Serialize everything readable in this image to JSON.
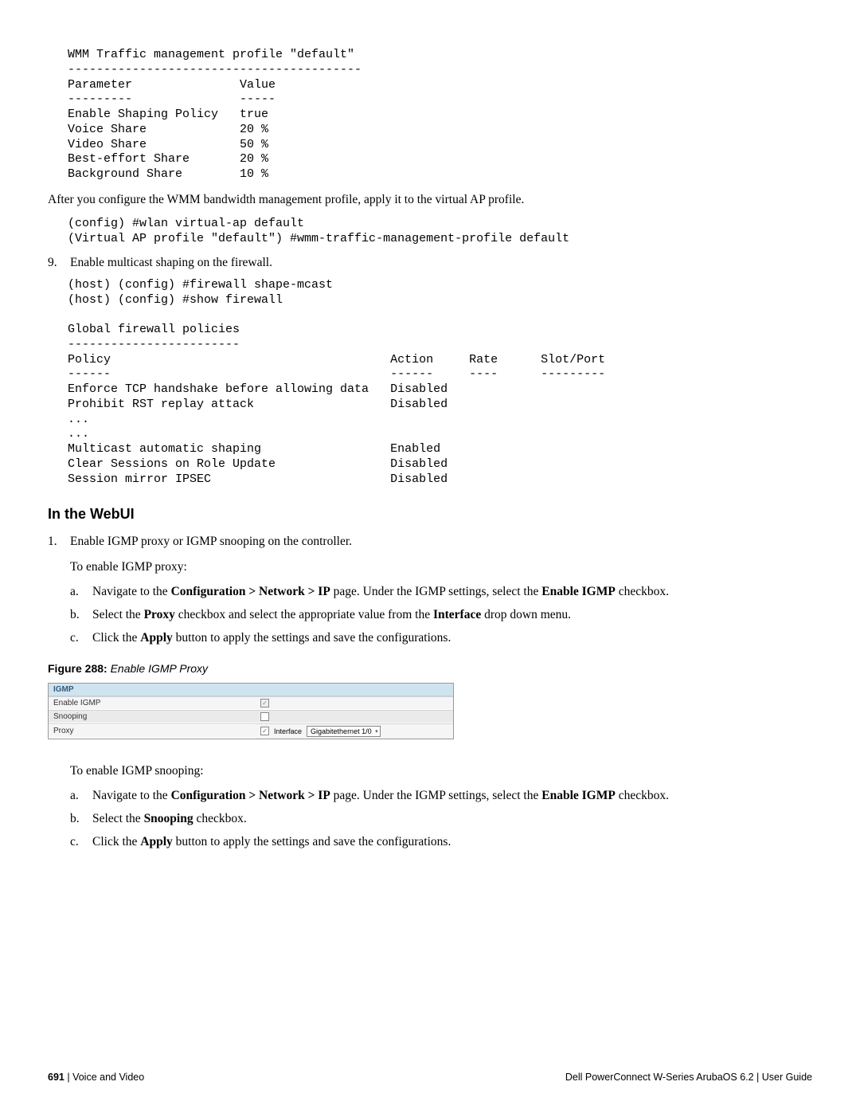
{
  "pre1": "WMM Traffic management profile \"default\"\n-----------------------------------------\nParameter               Value\n---------               -----\nEnable Shaping Policy   true\nVoice Share             20 %\nVideo Share             50 %\nBest-effort Share       20 %\nBackground Share        10 %",
  "after_pre1": "After you configure the WMM bandwidth management profile, apply it to the virtual AP profile.",
  "pre2": "(config) #wlan virtual-ap default\n(Virtual AP profile \"default\") #wmm-traffic-management-profile default",
  "step9_num": "9.",
  "step9_text": "Enable multicast shaping on the firewall.",
  "pre3": "(host) (config) #firewall shape-mcast\n(host) (config) #show firewall\n\nGlobal firewall policies\n------------------------\nPolicy                                       Action     Rate      Slot/Port\n------                                       ------     ----      ---------\nEnforce TCP handshake before allowing data   Disabled\nProhibit RST replay attack                   Disabled\n...\n...\nMulticast automatic shaping                  Enabled\nClear Sessions on Role Update                Disabled\nSession mirror IPSEC                         Disabled",
  "h2": "In the WebUI",
  "step1_num": "1.",
  "step1_text": "Enable IGMP proxy or IGMP snooping on the controller.",
  "proxy_intro": "To enable IGMP proxy:",
  "p_a_letter": "a.",
  "p_a_pre": "Navigate to the ",
  "p_a_path": "Configuration > Network > IP",
  "p_a_mid": " page. Under the IGMP settings, select the ",
  "p_a_bold2": "Enable IGMP",
  "p_a_post": " checkbox.",
  "p_b_letter": "b.",
  "p_b_pre": "Select the ",
  "p_b_bold1": "Proxy",
  "p_b_mid": " checkbox and select the appropriate value from the ",
  "p_b_bold2": "Interface",
  "p_b_post": " drop down menu.",
  "p_c_letter": "c.",
  "p_c_pre": "Click the ",
  "p_c_bold": "Apply",
  "p_c_post": " button to apply the settings and save the configurations.",
  "fig_label": "Figure 288:",
  "fig_title": " Enable IGMP Proxy",
  "fig": {
    "header": "IGMP",
    "row1_label": "Enable IGMP",
    "row1_check": "✓",
    "row2_label": "Snooping",
    "row3_label": "Proxy",
    "row3_check": "✓",
    "row3_iface_label": "Interface",
    "row3_iface_value": "Gigabitethernet 1/0"
  },
  "snoop_intro": "To enable IGMP snooping:",
  "s_a_letter": "a.",
  "s_a_pre": "Navigate to the ",
  "s_a_path": "Configuration > Network > IP",
  "s_a_mid": " page. Under the IGMP settings, select the ",
  "s_a_bold2": "Enable IGMP",
  "s_a_post": " checkbox.",
  "s_b_letter": "b.",
  "s_b_pre": "Select the ",
  "s_b_bold": "Snooping",
  "s_b_post": " checkbox.",
  "s_c_letter": "c.",
  "s_c_pre": "Click the ",
  "s_c_bold": "Apply",
  "s_c_post": " button to apply the settings and save the configurations.",
  "footer_page": "691",
  "footer_sep": " | ",
  "footer_section": "Voice and Video",
  "footer_right": "Dell PowerConnect W-Series ArubaOS 6.2  |  User Guide"
}
